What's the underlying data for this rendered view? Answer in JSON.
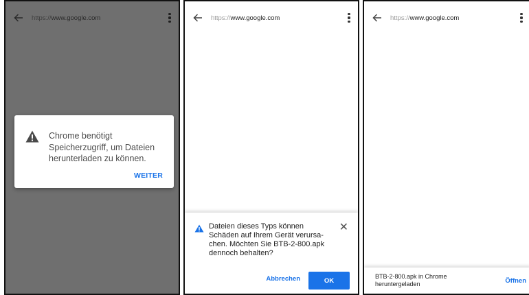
{
  "screens": [
    {
      "url_scheme": "https://",
      "url_host": "www.google.com",
      "dialog": {
        "message": "Chrome benötigt Speicherzugriff, um Dateien herunterladen zu können.",
        "button": "WEITER"
      }
    },
    {
      "url_scheme": "https://",
      "url_host": "www.google.com",
      "sheet": {
        "message": "Dateien dieses Typs können Schäden auf Ihrem Gerät verursa-chen. Möchten Sie BTB-2-800.apk dennoch behalten?",
        "cancel": "Abbrechen",
        "ok": "OK"
      }
    },
    {
      "url_scheme": "https://",
      "url_host": "www.google.com",
      "snackbar": {
        "message": "BTB-2-800.apk in Chrome heruntergeladen",
        "action": "Öffnen"
      }
    }
  ],
  "colors": {
    "accent": "#1a73e8",
    "scrim": "#6f6f6f",
    "border": "#111111"
  },
  "icons": [
    "back-arrow-icon",
    "more-vert-icon",
    "warning-icon",
    "close-icon"
  ]
}
